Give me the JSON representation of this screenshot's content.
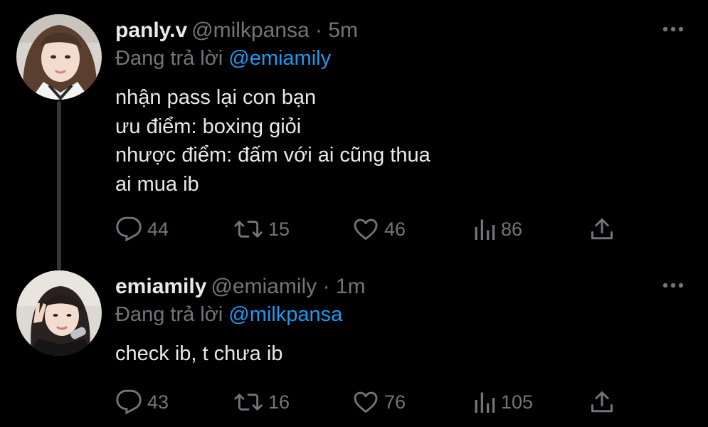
{
  "tweets": [
    {
      "name": "panly.v",
      "handle": "@milkpansa",
      "separator": "·",
      "time": "5m",
      "reply_prefix": "Đang trả lời",
      "reply_to": "@emiamily",
      "lines": [
        "nhận pass lại con bạn",
        "ưu điểm: boxing giỏi",
        "nhược điểm: đấm với ai cũng thua",
        "ai mua ib"
      ],
      "stats": {
        "replies": "44",
        "retweets": "15",
        "likes": "46",
        "views": "86"
      }
    },
    {
      "name": "emiamily",
      "handle": "@emiamily",
      "separator": "·",
      "time": "1m",
      "reply_prefix": "Đang trả lời",
      "reply_to": "@milkpansa",
      "lines": [
        "check ib, t chưa ib"
      ],
      "stats": {
        "replies": "43",
        "retweets": "16",
        "likes": "76",
        "views": "105"
      }
    }
  ],
  "icons": {
    "reply": "speech-bubble-icon",
    "retweet": "retweet-icon",
    "like": "heart-icon",
    "views": "bar-chart-icon",
    "share": "upload-icon",
    "more": "ellipsis-icon"
  },
  "colors": {
    "background": "#000000",
    "text": "#e7e9ea",
    "muted": "#71767b",
    "link": "#1d9bf0",
    "thread_line": "#333639"
  }
}
